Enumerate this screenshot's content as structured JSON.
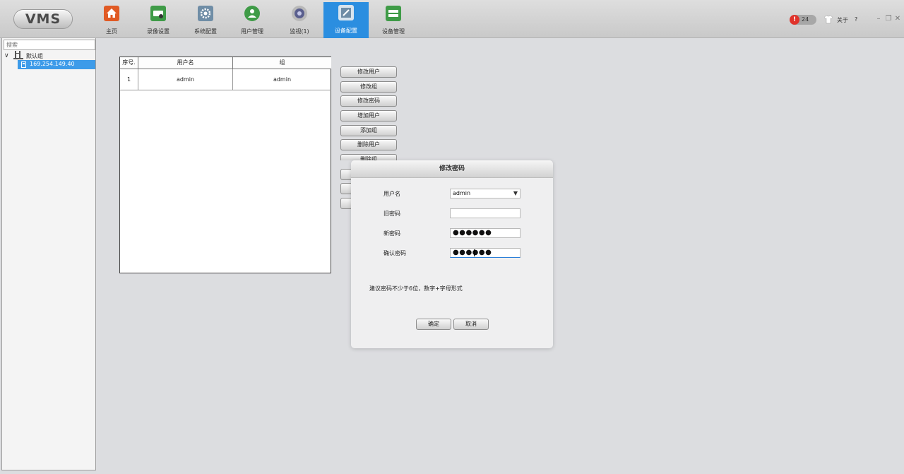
{
  "app": {
    "logo": "VMS"
  },
  "nav": {
    "items": [
      {
        "label": "主页",
        "icon": "home-icon",
        "color": "#e05a24"
      },
      {
        "label": "录像设置",
        "icon": "recording-settings-icon",
        "color": "#3f9b47"
      },
      {
        "label": "系统配置",
        "icon": "gear-icon",
        "color": "#6f8da6"
      },
      {
        "label": "用户管理",
        "icon": "user-management-icon",
        "color": "#3f9b47"
      },
      {
        "label": "监视(1)",
        "icon": "camera-icon",
        "color": "#5a5f8e"
      },
      {
        "label": "设备配置",
        "icon": "device-config-icon",
        "color": "#6f8da6",
        "active": true
      },
      {
        "label": "设备管理",
        "icon": "device-management-icon",
        "color": "#3f9b47"
      }
    ],
    "active_color": "#2b8ee0"
  },
  "header_right": {
    "alert_symbol": "!",
    "alert_count": "24",
    "about_label": "关于",
    "help_label": "?",
    "minimize": "–",
    "restore": "❐",
    "close": "✕"
  },
  "sidebar": {
    "search_placeholder": "搜索",
    "tree_toggle": "∨",
    "group_label": "默认组",
    "device_label": "169.254.149.40"
  },
  "table": {
    "columns": [
      "序号.",
      "用户名",
      "组"
    ],
    "rows": [
      [
        "1",
        "admin",
        "admin"
      ]
    ]
  },
  "actions": {
    "buttons": [
      "修改用户",
      "修改组",
      "修改密码",
      "增加用户",
      "添加组",
      "删除用户",
      "删除组"
    ]
  },
  "dialog": {
    "title": "修改密码",
    "username_label": "用户名",
    "username_value": "admin",
    "old_password_label": "旧密码",
    "old_password_value": "",
    "new_password_label": "新密码",
    "new_password_value": "●●●●●●",
    "confirm_password_label": "确认密码",
    "confirm_password_value": "●●●●●●",
    "hint": "建议密码不少于6位，数字+字母形式",
    "ok_label": "确定",
    "cancel_label": "取消"
  }
}
